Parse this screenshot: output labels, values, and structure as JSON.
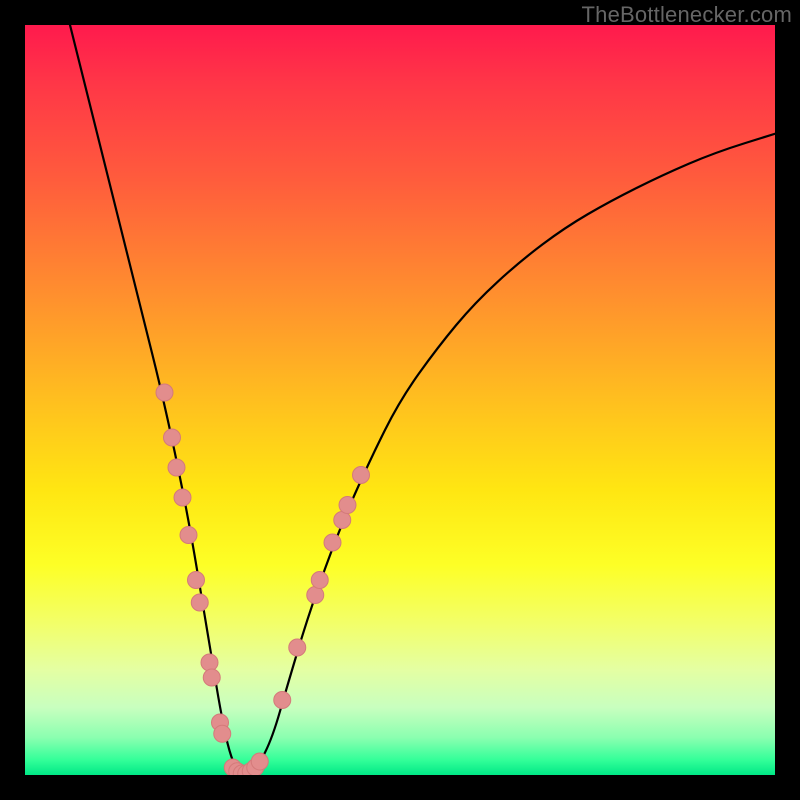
{
  "watermark": "TheBottlenecker.com",
  "chart_data": {
    "type": "line",
    "title": "",
    "xlabel": "",
    "ylabel": "",
    "xlim": [
      0,
      100
    ],
    "ylim": [
      0,
      100
    ],
    "series": [
      {
        "name": "bottleneck-curve",
        "color": "#000000",
        "stroke_width": 2.2,
        "x": [
          6,
          8,
          10,
          12,
          14,
          16,
          18,
          20,
          22,
          24,
          25,
          26,
          27,
          28,
          29,
          30,
          31,
          33,
          35,
          38,
          42,
          46,
          50,
          55,
          60,
          66,
          72,
          78,
          85,
          92,
          100
        ],
        "y": [
          100,
          92,
          84,
          76,
          68,
          60,
          52,
          43,
          33,
          21,
          15,
          9,
          4,
          1,
          0,
          0,
          1,
          5,
          12,
          22,
          33,
          42,
          50,
          57,
          63,
          68.5,
          73,
          76.5,
          80,
          83,
          85.5
        ]
      }
    ],
    "markers": {
      "name": "sample-points",
      "fill": "#e28d8d",
      "stroke": "#d47a7a",
      "radius": 8.5,
      "points": [
        {
          "x": 18.6,
          "y": 51
        },
        {
          "x": 19.6,
          "y": 45
        },
        {
          "x": 20.2,
          "y": 41
        },
        {
          "x": 21.0,
          "y": 37
        },
        {
          "x": 21.8,
          "y": 32
        },
        {
          "x": 22.8,
          "y": 26
        },
        {
          "x": 23.3,
          "y": 23
        },
        {
          "x": 24.6,
          "y": 15
        },
        {
          "x": 24.9,
          "y": 13
        },
        {
          "x": 26.0,
          "y": 7
        },
        {
          "x": 26.3,
          "y": 5.5
        },
        {
          "x": 27.7,
          "y": 1.0
        },
        {
          "x": 28.3,
          "y": 0.5
        },
        {
          "x": 28.9,
          "y": 0.2
        },
        {
          "x": 29.5,
          "y": 0.2
        },
        {
          "x": 30.1,
          "y": 0.5
        },
        {
          "x": 30.7,
          "y": 1.0
        },
        {
          "x": 31.3,
          "y": 1.8
        },
        {
          "x": 34.3,
          "y": 10
        },
        {
          "x": 36.3,
          "y": 17
        },
        {
          "x": 38.7,
          "y": 24
        },
        {
          "x": 39.3,
          "y": 26
        },
        {
          "x": 41.0,
          "y": 31
        },
        {
          "x": 42.3,
          "y": 34
        },
        {
          "x": 43.0,
          "y": 36
        },
        {
          "x": 44.8,
          "y": 40
        }
      ]
    },
    "background_type": "vertical-rainbow-gradient"
  }
}
